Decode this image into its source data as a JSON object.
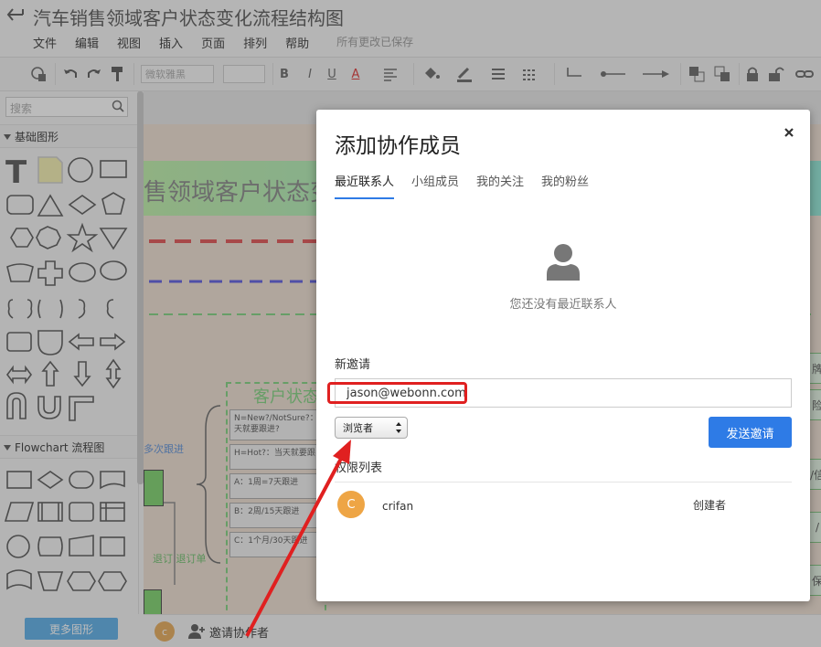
{
  "header": {
    "title": "汽车销售领域客户状态变化流程结构图",
    "menu": [
      "文件",
      "编辑",
      "视图",
      "插入",
      "页面",
      "排列",
      "帮助"
    ],
    "save_status": "所有更改已保存"
  },
  "toolbar": {
    "font_name": "微软雅黑",
    "font_size": "",
    "bold": "B",
    "italic": "I",
    "underline": "U",
    "font_color": "A",
    "icons": [
      "format-painter-icon",
      "undo-icon",
      "redo-icon",
      "paint-brush-icon",
      "align-icon",
      "fill-icon",
      "line-color-icon",
      "line-width-icon",
      "line-style-icon",
      "connector-icon",
      "line-start-icon",
      "line-end-icon",
      "bring-front-icon",
      "send-back-icon",
      "lock-icon",
      "unlock-icon",
      "link-icon"
    ]
  },
  "sidebar": {
    "search_placeholder": "搜索",
    "section_basic": "基础图形",
    "section_flowchart": "Flowchart 流程图",
    "more_shapes": "更多图形"
  },
  "canvas": {
    "banner_text": "售领域客户状态变",
    "state_title": "客户状态",
    "state_boxes": [
      "N=New?/NotSure?：\n天就要跟进?",
      "H=Hot?：当天就要跟",
      "A：1周=7天跟进",
      "B：2周/15天跟进",
      "C：1个月/30天跟进"
    ],
    "blue_label": "多次跟进",
    "green_label": "退订  退订单",
    "right_cells": [
      "牌",
      "险",
      "/信",
      "/",
      "保"
    ]
  },
  "bottom": {
    "avatar_letter": "c",
    "invite_label": "邀请协作者"
  },
  "dialog": {
    "title": "添加协作成员",
    "close": "×",
    "tabs": [
      "最近联系人",
      "小组成员",
      "我的关注",
      "我的粉丝"
    ],
    "empty_text": "您还没有最近联系人",
    "new_invite_label": "新邀请",
    "email_value": "jason@webonn.com",
    "role_selected": "浏览者",
    "send_button": "发送邀请",
    "permission_label": "权限列表",
    "permissions": [
      {
        "avatar": "C",
        "name": "crifan",
        "role": "创建者"
      }
    ]
  },
  "colors": {
    "accent_blue": "#2e7be6",
    "highlight_red": "#e02020",
    "avatar_orange": "#eea545"
  }
}
